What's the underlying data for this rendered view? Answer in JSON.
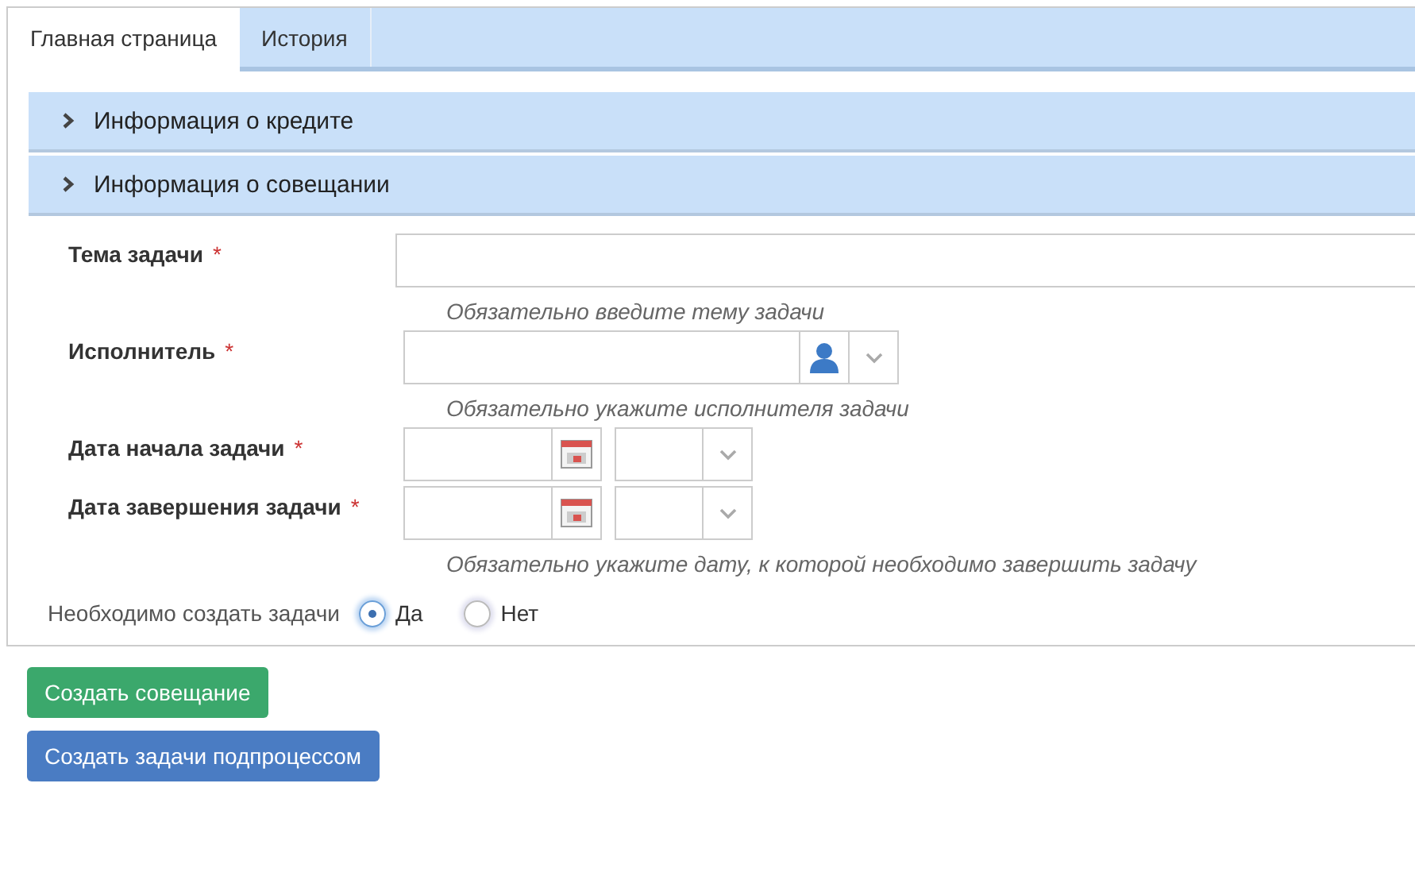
{
  "tabs": [
    {
      "label": "Главная страница",
      "selected": true
    },
    {
      "label": "История",
      "selected": false
    }
  ],
  "sections": [
    {
      "title": "Информация о кредите",
      "expanded": false
    },
    {
      "title": "Информация о совещании",
      "expanded": false
    }
  ],
  "fields": [
    {
      "kind": "text",
      "label": "Тема задачи",
      "required_mark": "*",
      "hint": "Обязательно введите тему задачи"
    },
    {
      "kind": "user",
      "label": "Исполнитель",
      "required_mark": "*",
      "hint": "Обязательно укажите исполнителя задачи"
    },
    {
      "kind": "datetime",
      "label": "Дата начала задачи",
      "required_mark": "*"
    },
    {
      "kind": "datetime",
      "label": "Дата завершения задачи",
      "required_mark": "*",
      "hint": "Обязательно укажите дату, к которой необходимо завершить задачу"
    }
  ],
  "create_tasks": {
    "label": "Необходимо создать задачи",
    "options": [
      {
        "label": "Да",
        "selected": true
      },
      {
        "label": "Нет",
        "selected": false
      }
    ]
  },
  "buttons": [
    {
      "label": "Создать совещание",
      "kind": "success"
    },
    {
      "label": "Создать задачи подпроцессом",
      "kind": "primary"
    }
  ]
}
